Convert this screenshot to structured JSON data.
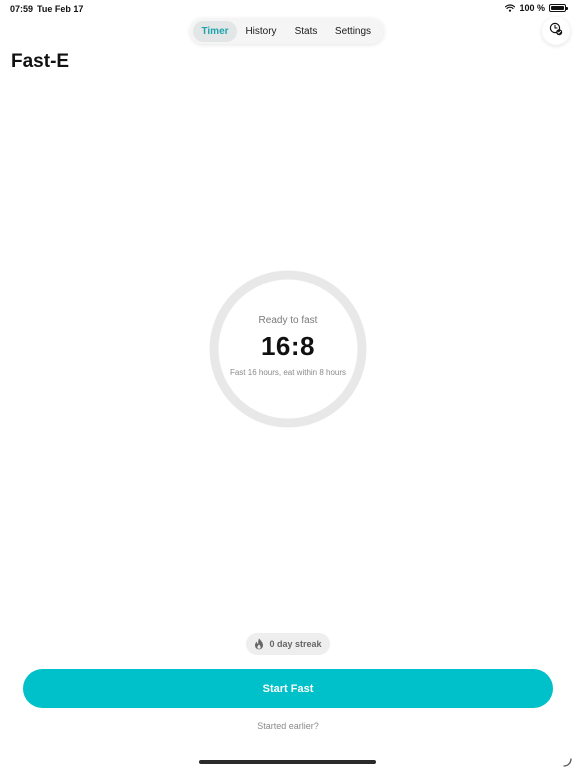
{
  "status_bar": {
    "time": "07:59",
    "date": "Tue Feb 17",
    "battery_percent": "100 %",
    "icons": [
      "wifi-icon",
      "battery-icon"
    ]
  },
  "tabs": [
    {
      "label": "Timer",
      "active": true
    },
    {
      "label": "History",
      "active": false
    },
    {
      "label": "Stats",
      "active": false
    },
    {
      "label": "Settings",
      "active": false
    }
  ],
  "header": {
    "title": "Fast-E",
    "action_icon": "clock-check-icon"
  },
  "timer": {
    "status": "Ready to fast",
    "ratio": "16:8",
    "description": "Fast 16 hours, eat within 8 hours",
    "progress": 0
  },
  "streak": {
    "icon": "flame-icon",
    "label": "0 day streak"
  },
  "actions": {
    "start_label": "Start Fast",
    "started_earlier_label": "Started earlier?"
  },
  "colors": {
    "accent": "#00c1c9",
    "active_tab_text": "#1fa3ad",
    "ring_track": "#e8e8e8"
  }
}
